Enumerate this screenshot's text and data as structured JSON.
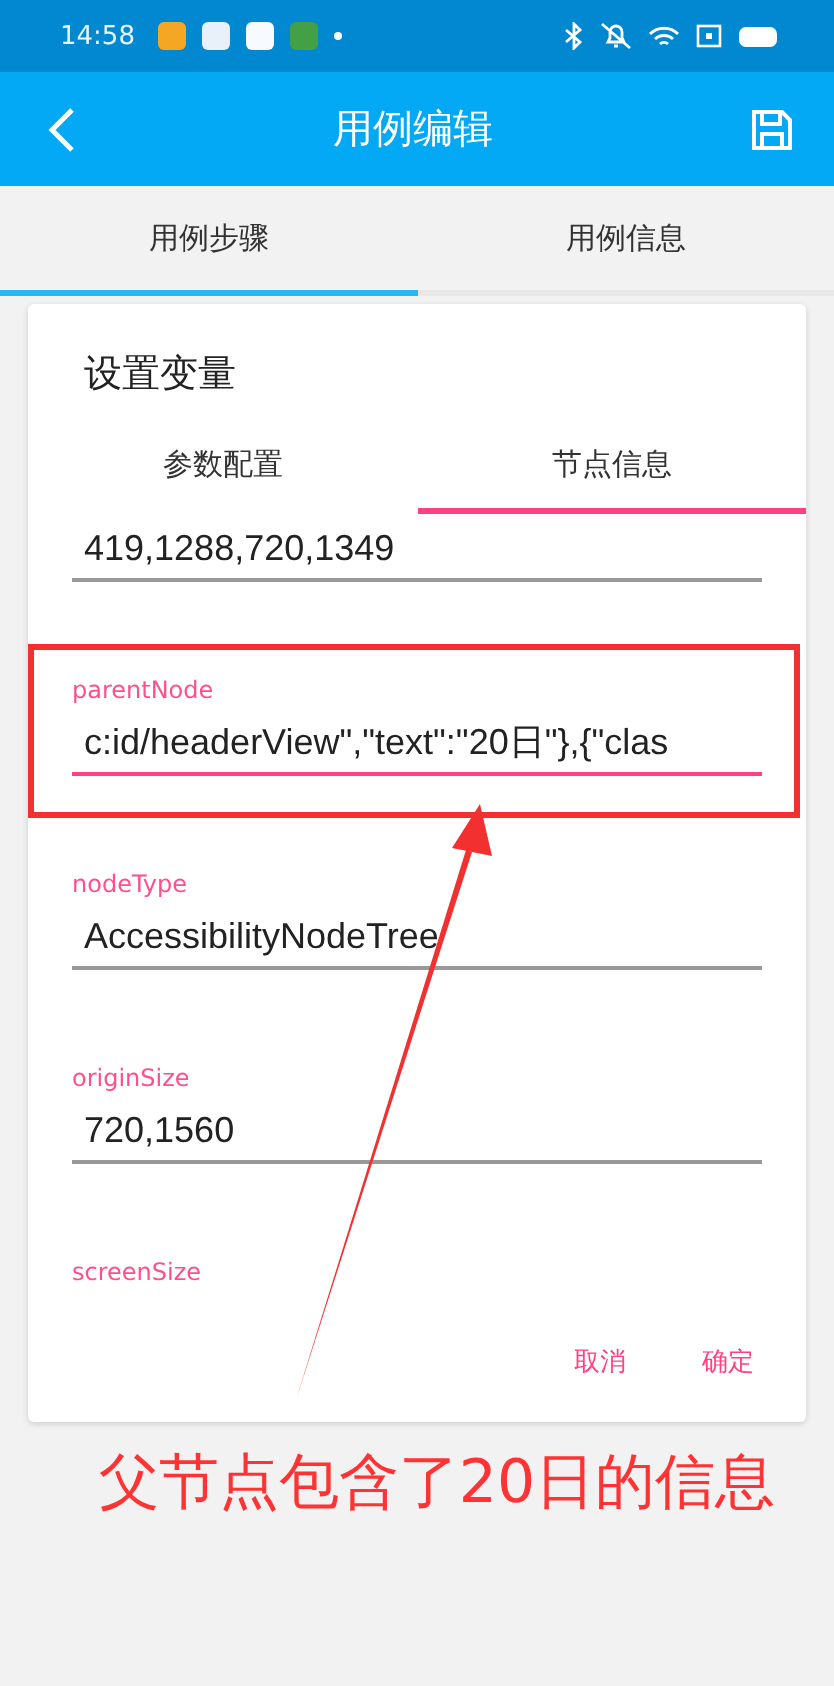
{
  "status_bar": {
    "time": "14:58"
  },
  "app_bar": {
    "title": "用例编辑"
  },
  "tabs": [
    {
      "label": "用例步骤",
      "selected": true
    },
    {
      "label": "用例信息",
      "selected": false
    }
  ],
  "dialog": {
    "title": "设置变量",
    "tabs": [
      {
        "label": "参数配置",
        "selected": false
      },
      {
        "label": "节点信息",
        "selected": true
      }
    ],
    "fields": [
      {
        "value": "419,1288,720,1349",
        "focused": false
      },
      {
        "label": "parentNode",
        "value": "c:id/headerView\",\"text\":\"20日\"},{\"clas",
        "focused": true
      },
      {
        "label": "nodeType",
        "value": "AccessibilityNodeTree",
        "focused": false
      },
      {
        "label": "originSize",
        "value": "720,1560",
        "focused": false
      },
      {
        "label": "screenSize"
      }
    ],
    "buttons": [
      "取消",
      "确定"
    ]
  },
  "annotation": {
    "caption": "父节点包含了20日的信息"
  }
}
